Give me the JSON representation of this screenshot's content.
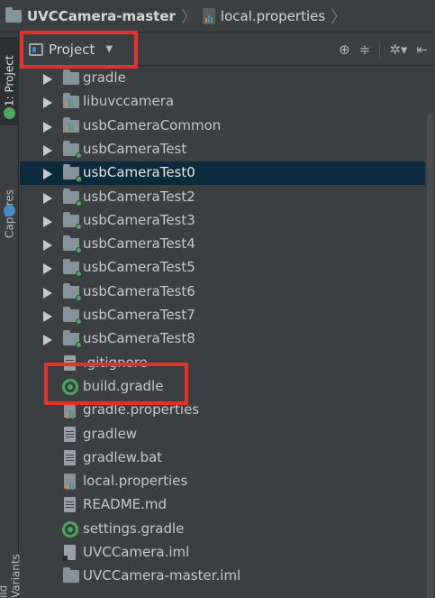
{
  "breadcrumb": {
    "project": "UVCCamera-master",
    "file": "local.properties"
  },
  "tool_strip": {
    "project_tab": "1: Project",
    "captures_tab": "Captures",
    "variants_tab": "ild Variants"
  },
  "panel": {
    "view_label": "Project",
    "tools": [
      "locate-icon",
      "collapse-icon",
      "settings-icon",
      "hide-icon"
    ]
  },
  "tree": {
    "items": [
      {
        "label": "gradle",
        "kind": "folder",
        "expandable": true
      },
      {
        "label": "libuvccamera",
        "kind": "module-lib",
        "expandable": true
      },
      {
        "label": "usbCameraCommon",
        "kind": "module-lib",
        "expandable": true
      },
      {
        "label": "usbCameraTest",
        "kind": "module-app",
        "expandable": true
      },
      {
        "label": "usbCameraTest0",
        "kind": "module-app",
        "expandable": true,
        "selected": true
      },
      {
        "label": "usbCameraTest2",
        "kind": "module-app",
        "expandable": true
      },
      {
        "label": "usbCameraTest3",
        "kind": "module-app",
        "expandable": true
      },
      {
        "label": "usbCameraTest4",
        "kind": "module-app",
        "expandable": true
      },
      {
        "label": "usbCameraTest5",
        "kind": "module-app",
        "expandable": true
      },
      {
        "label": "usbCameraTest6",
        "kind": "module-app",
        "expandable": true
      },
      {
        "label": "usbCameraTest7",
        "kind": "module-app",
        "expandable": true
      },
      {
        "label": "usbCameraTest8",
        "kind": "module-app",
        "expandable": true
      },
      {
        "label": ".gitignore",
        "kind": "file"
      },
      {
        "label": "build.gradle",
        "kind": "gradle"
      },
      {
        "label": "gradle.properties",
        "kind": "props"
      },
      {
        "label": "gradlew",
        "kind": "file"
      },
      {
        "label": "gradlew.bat",
        "kind": "file"
      },
      {
        "label": "local.properties",
        "kind": "props"
      },
      {
        "label": "README.md",
        "kind": "file"
      },
      {
        "label": "settings.gradle",
        "kind": "gradle"
      },
      {
        "label": "UVCCamera.iml",
        "kind": "iml"
      },
      {
        "label": "UVCCamera-master.iml",
        "kind": "folder-plain"
      }
    ]
  },
  "colors": {
    "selection": "#0d293e",
    "highlight_box": "#e8302a",
    "module_dot": "#4ca75a"
  }
}
